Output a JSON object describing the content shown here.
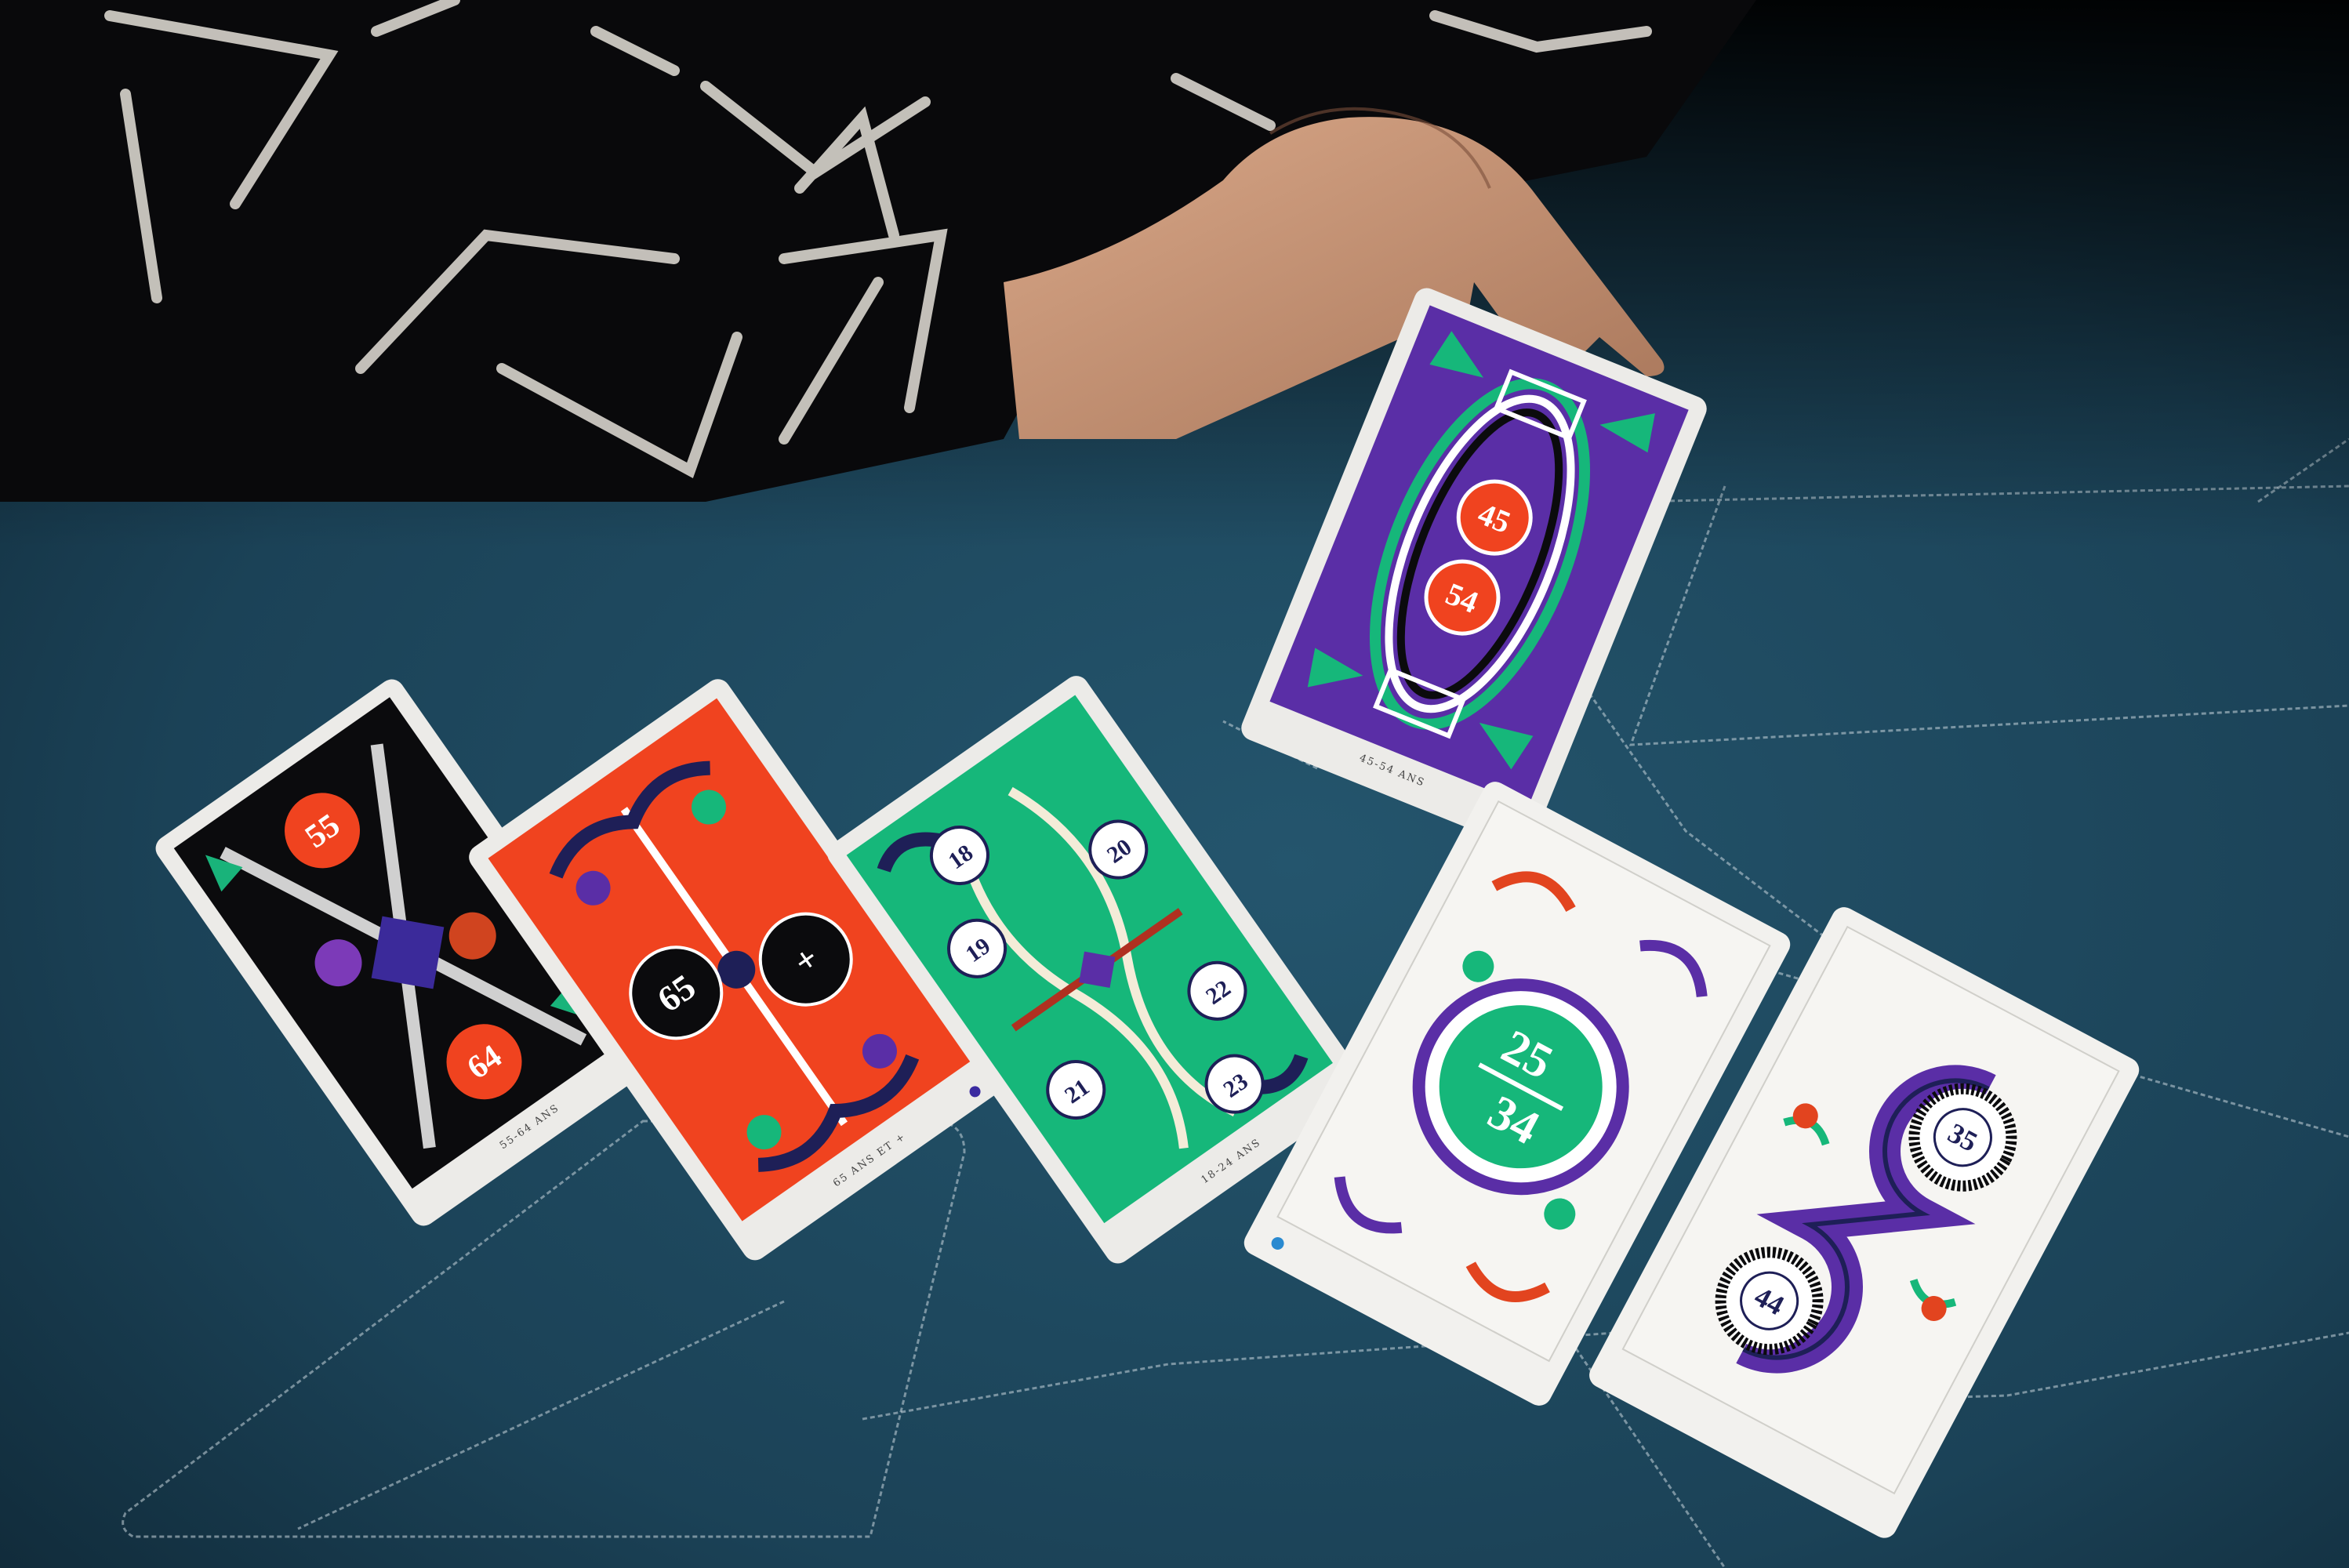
{
  "colors": {
    "table_felt": "#1f4a60",
    "table_felt_dark": "#102a38",
    "sleeve_black": "#0a0a0c",
    "card_border": "#eceae6",
    "red_orange": "#f0431f",
    "green": "#16b77a",
    "purple": "#5a2ea6",
    "navy": "#1e1f57"
  },
  "cards": [
    {
      "id": "card-55-64",
      "theme": "black",
      "numbers": [
        "55",
        "64"
      ],
      "caption": "55-64 ANS",
      "dot_color": "#d62020"
    },
    {
      "id": "card-65-plus",
      "theme": "orange",
      "numbers": [
        "65",
        "+"
      ],
      "caption": "65 ANS ET +",
      "dot_color": "#3a2aa0"
    },
    {
      "id": "card-18-24",
      "theme": "green",
      "numbers": [
        "18",
        "19",
        "20",
        "21",
        "22",
        "23"
      ],
      "caption": "18-24 ANS",
      "dot_color": "#f1c21b"
    },
    {
      "id": "card-45-54",
      "theme": "purple",
      "numbers": [
        "45",
        "54"
      ],
      "caption": "45-54 ANS",
      "dot_color": "#18a050"
    },
    {
      "id": "card-25-34",
      "theme": "white",
      "numbers": [
        "25",
        "34"
      ],
      "caption": "",
      "dot_color": "#2a8ad0"
    },
    {
      "id": "card-35-44",
      "theme": "white",
      "numbers": [
        "35",
        "44"
      ],
      "caption": "",
      "dot_color": ""
    }
  ]
}
